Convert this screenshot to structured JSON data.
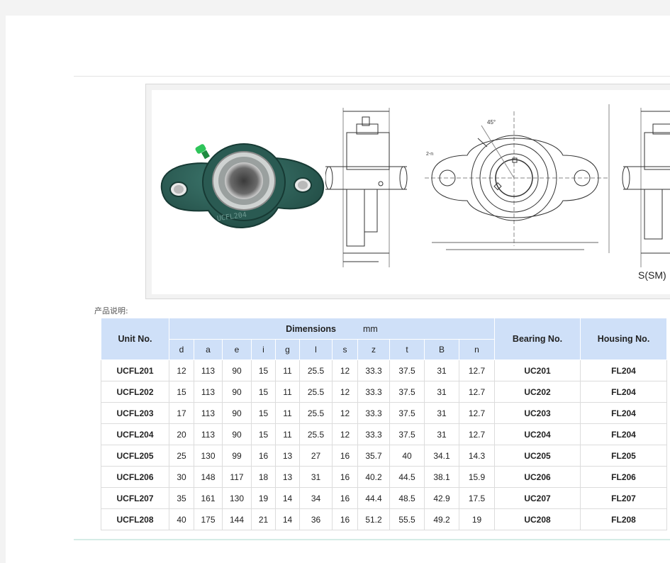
{
  "caption": "产品说明:",
  "drawing_label": "S(SM)",
  "table": {
    "headers": {
      "unit_no": "Unit No.",
      "dimensions": "Dimensions",
      "unit": "mm",
      "bearing_no": "Bearing No.",
      "housing_no": "Housing No.",
      "dims": [
        "d",
        "a",
        "e",
        "i",
        "g",
        "l",
        "s",
        "z",
        "t",
        "B",
        "n"
      ]
    },
    "rows": [
      {
        "unit": "UCFL201",
        "d": "12",
        "a": "113",
        "e": "90",
        "i": "15",
        "g": "11",
        "l": "25.5",
        "s": "12",
        "z": "33.3",
        "t": "37.5",
        "B": "31",
        "n": "12.7",
        "bearing": "UC201",
        "housing": "FL204"
      },
      {
        "unit": "UCFL202",
        "d": "15",
        "a": "113",
        "e": "90",
        "i": "15",
        "g": "11",
        "l": "25.5",
        "s": "12",
        "z": "33.3",
        "t": "37.5",
        "B": "31",
        "n": "12.7",
        "bearing": "UC202",
        "housing": "FL204"
      },
      {
        "unit": "UCFL203",
        "d": "17",
        "a": "113",
        "e": "90",
        "i": "15",
        "g": "11",
        "l": "25.5",
        "s": "12",
        "z": "33.3",
        "t": "37.5",
        "B": "31",
        "n": "12.7",
        "bearing": "UC203",
        "housing": "FL204"
      },
      {
        "unit": "UCFL204",
        "d": "20",
        "a": "113",
        "e": "90",
        "i": "15",
        "g": "11",
        "l": "25.5",
        "s": "12",
        "z": "33.3",
        "t": "37.5",
        "B": "31",
        "n": "12.7",
        "bearing": "UC204",
        "housing": "FL204"
      },
      {
        "unit": "UCFL205",
        "d": "25",
        "a": "130",
        "e": "99",
        "i": "16",
        "g": "13",
        "l": "27",
        "s": "16",
        "z": "35.7",
        "t": "40",
        "B": "34.1",
        "n": "14.3",
        "bearing": "UC205",
        "housing": "FL205"
      },
      {
        "unit": "UCFL206",
        "d": "30",
        "a": "148",
        "e": "117",
        "i": "18",
        "g": "13",
        "l": "31",
        "s": "16",
        "z": "40.2",
        "t": "44.5",
        "B": "38.1",
        "n": "15.9",
        "bearing": "UC206",
        "housing": "FL206"
      },
      {
        "unit": "UCFL207",
        "d": "35",
        "a": "161",
        "e": "130",
        "i": "19",
        "g": "14",
        "l": "34",
        "s": "16",
        "z": "44.4",
        "t": "48.5",
        "B": "42.9",
        "n": "17.5",
        "bearing": "UC207",
        "housing": "FL207"
      },
      {
        "unit": "UCFL208",
        "d": "40",
        "a": "175",
        "e": "144",
        "i": "21",
        "g": "14",
        "l": "36",
        "s": "16",
        "z": "51.2",
        "t": "55.5",
        "B": "49.2",
        "n": "19",
        "bearing": "UC208",
        "housing": "FL208"
      }
    ]
  },
  "colors": {
    "header_bg": "#cfe0f8",
    "housing_green": "#2e5f56",
    "grease_nipple": "#2ec45a"
  }
}
